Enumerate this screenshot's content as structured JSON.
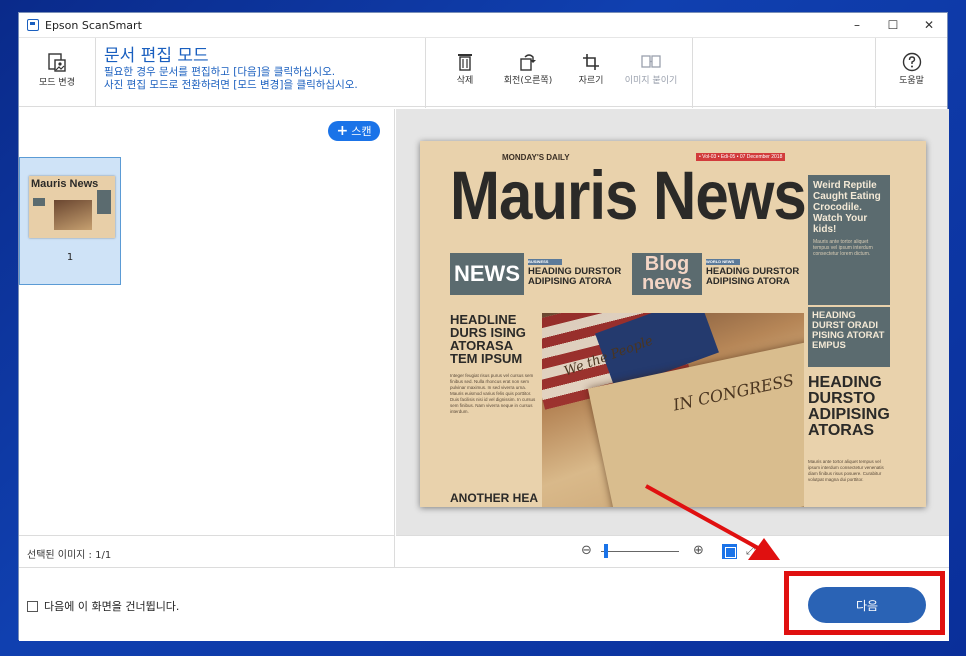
{
  "window": {
    "title": "Epson ScanSmart",
    "controls": {
      "minimize": "–",
      "maximize": "☐",
      "close": "✕"
    }
  },
  "toolbar": {
    "mode_change_label": "모드 변경",
    "mode_title": "문서 편집 모드",
    "mode_desc_line1": "필요한 경우 문서를 편집하고 [다음]을 클릭하십시오.",
    "mode_desc_line2": "사진 편집 모드로 전환하려면 [모드 변경]을 클릭하십시오.",
    "delete_label": "삭제",
    "rotate_label": "회전(오른쪽)",
    "crop_label": "자르기",
    "stitch_label": "이미지 붙이기",
    "help_label": "도움말"
  },
  "left_panel": {
    "scan_label": "스캔",
    "thumbnail_number": "1",
    "thumbnail_title": "Mauris News",
    "selected_images": "선택된 이미지 : 1/1"
  },
  "preview": {
    "daily": "MONDAY'S DAILY",
    "issue": "• Vol-03 • Edi-05 • 07 December 2018",
    "masthead": "Mauris News",
    "side_headline": "Weird Reptile Caught Eating Crocodile. Watch Your kids!",
    "side_text": "Mauris ante tortor aliquet tempus vel ipsum interdum consectetur lorem dictum.",
    "news_box": "NEWS",
    "col1_tag": "BUSINESS",
    "col1_headline": "HEADING DURSTOR ADIPISING ATORA",
    "blog_box": "Blog news",
    "col2_tag": "WORLD NEWS",
    "col2_headline": "HEADING DURSTOR ADIPISING ATORA",
    "finance_headline": "HEADING DURST ORADI PISING ATORAT EMPUS",
    "left_headline": "HEADLINE DURS ISING ATORASA TEM IPSUM",
    "left_text": "Integer feugiat risus purus vel cursus sem finibus sed. Nulla rhoncus erat non sem pulvinar maximus. In sed viverra urna. Mauris euismod varius felis quis porttitor. Duis facilisis nisi id vel dignissim. In cursus sem finibus. Nam viverra neque in cursus interdum.",
    "another_headline": "ANOTHER HEA",
    "photo_text1": "We the People",
    "photo_text2": "IN CONGRESS",
    "right_headline": "HEADING DURSTO ADIPISING ATORAS",
    "right_text": "Mauris ante tortor aliquet tempus vel ipsum interdum consectetur venenatis diam finibus risus posuere. Curabitur volutpat magna dui porttitor."
  },
  "zoom": {
    "minus_icon": "⊖",
    "plus_icon": "⊕",
    "level_fraction": 0.05
  },
  "bottom": {
    "skip_label": "다음에 이 화면을 건너뜁니다.",
    "next_label": "다음"
  },
  "colors": {
    "accent": "#1a73e8",
    "primary_button": "#2a63b5",
    "highlight": "#e01010"
  }
}
